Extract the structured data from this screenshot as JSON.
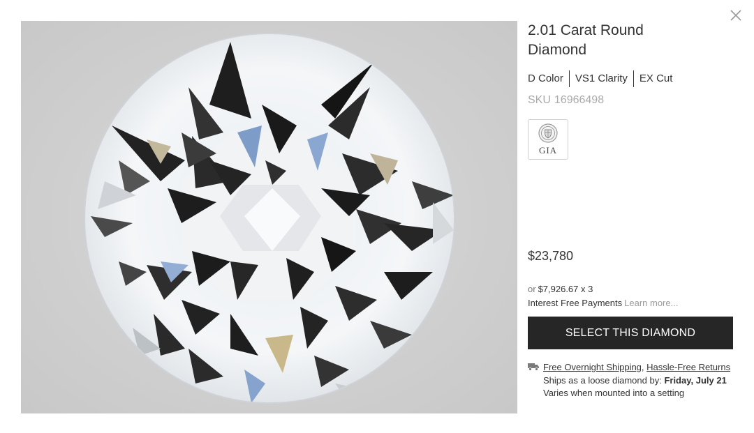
{
  "modal": {
    "close_icon": "close-icon"
  },
  "product": {
    "title": "2.01 Carat Round Diamond",
    "specs": {
      "color": "D Color",
      "clarity": "VS1 Clarity",
      "cut": "EX Cut"
    },
    "sku_label": "SKU",
    "sku_value": "16966498",
    "certificate": {
      "lab": "GIA",
      "icon": "gia-seal-icon"
    },
    "image_alt_icon": "diamond-image"
  },
  "pricing": {
    "price": "$23,780",
    "installment_prefix": "or",
    "installment_amount": "$7,926.67 x 3",
    "interest_text": "Interest Free Payments",
    "learn_more": "Learn more..."
  },
  "actions": {
    "select_label": "SELECT THIS DIAMOND"
  },
  "shipping": {
    "icon": "truck-icon",
    "free_shipping_link": "Free Overnight Shipping",
    "separator": ", ",
    "returns_link": "Hassle-Free Returns",
    "ships_prefix": "Ships as a loose diamond by: ",
    "ship_date": "Friday, July 21",
    "note": "Varies when mounted into a setting"
  },
  "colors": {
    "button_bg": "#262626",
    "muted": "#aaaaaa",
    "text": "#333333"
  }
}
